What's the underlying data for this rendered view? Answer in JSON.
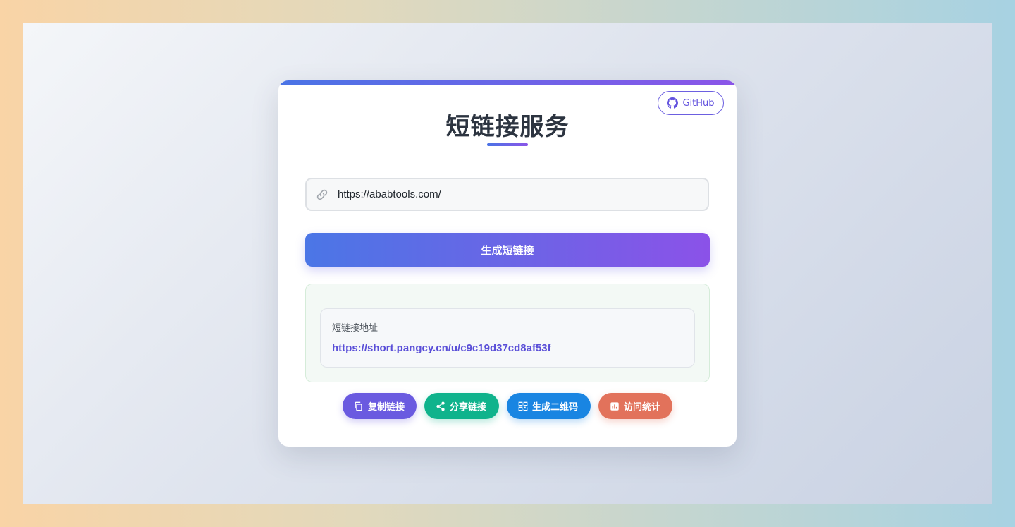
{
  "header": {
    "title": "短链接服务",
    "github_label": "GitHub"
  },
  "form": {
    "url_value": "https://ababtools.com/",
    "generate_label": "生成短链接"
  },
  "result": {
    "label": "短链接地址",
    "short_url": "https://short.pangcy.cn/u/c9c19d37cd8af53f"
  },
  "actions": [
    {
      "label": "复制链接",
      "icon": "copy-icon",
      "color": "#6a5ae0"
    },
    {
      "label": "分享链接",
      "icon": "share-icon",
      "color": "#0fb38c"
    },
    {
      "label": "生成二维码",
      "icon": "qrcode-icon",
      "color": "#1985e2"
    },
    {
      "label": "访问统计",
      "icon": "chart-icon",
      "color": "#e2725b"
    }
  ],
  "colors": {
    "accent_start": "#4a74e6",
    "accent_end": "#8b55e8"
  }
}
